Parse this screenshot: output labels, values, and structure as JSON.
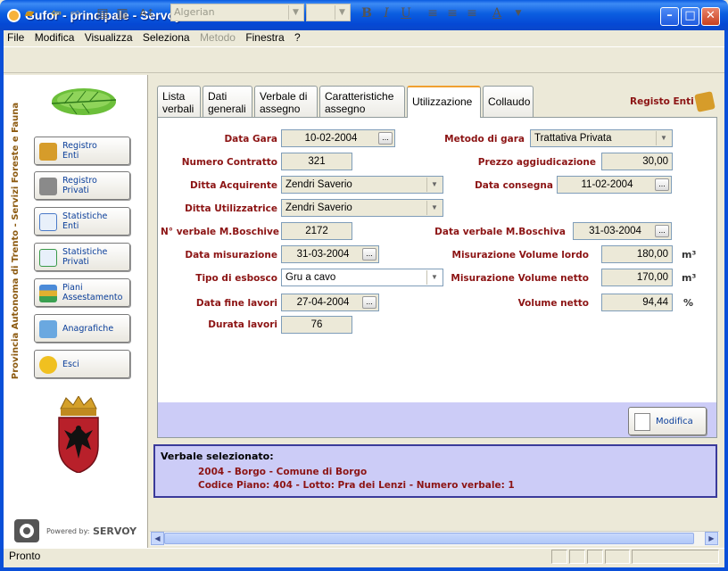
{
  "window": {
    "title": "Gufor - principale - Servoy Client"
  },
  "menu": [
    "File",
    "Modifica",
    "Visualizza",
    "Seleziona",
    "Metodo",
    "Finestra",
    "?"
  ],
  "menu_disabled": [
    "Metodo"
  ],
  "toolbar": {
    "font_name": "Algerian"
  },
  "sidebar": {
    "vertical_label": "Provincia Autonoma di Trento - Servizi Foreste e Fauna",
    "items": [
      {
        "label": "Registro\nEnti",
        "icon": "book-icon"
      },
      {
        "label": "Registro\nPrivati",
        "icon": "book-icon"
      },
      {
        "label": "Statistiche\nEnti",
        "icon": "chart-icon"
      },
      {
        "label": "Statistiche\nPrivati",
        "icon": "chart-icon"
      },
      {
        "label": "Piani\nAssestamento",
        "icon": "books-icon"
      },
      {
        "label": "Anagrafiche",
        "icon": "contact-card-icon"
      },
      {
        "label": "Esci",
        "icon": "footprints-icon"
      }
    ],
    "powered_by": "Powered by:",
    "brand": "SERVOY"
  },
  "tabs": [
    {
      "label": "Lista\nverbali"
    },
    {
      "label": "Dati\ngenerali"
    },
    {
      "label": "Verbale di\nassegno"
    },
    {
      "label": "Caratteristiche\nassegno"
    },
    {
      "label": "Utilizzazione",
      "active": true
    },
    {
      "label": "Collaudo"
    }
  ],
  "registo_link": "Registo Enti",
  "form": {
    "data_gara": {
      "label": "Data Gara",
      "value": "10-02-2004"
    },
    "numero_contratto": {
      "label": "Numero Contratto",
      "value": "321"
    },
    "ditta_acquirente": {
      "label": "Ditta Acquirente",
      "value": "Zendri Saverio"
    },
    "ditta_utilizzatrice": {
      "label": "Ditta Utilizzatrice",
      "value": "Zendri Saverio"
    },
    "n_verbale": {
      "label": "N° verbale M.Boschive",
      "value": "2172"
    },
    "data_misurazione": {
      "label": "Data misurazione",
      "value": "31-03-2004"
    },
    "tipo_esbosco": {
      "label": "Tipo di esbosco",
      "value": "Gru a cavo"
    },
    "data_fine_lavori": {
      "label": "Data fine lavori",
      "value": "27-04-2004"
    },
    "durata_lavori": {
      "label": "Durata lavori",
      "value": "76"
    },
    "metodo_gara": {
      "label": "Metodo di gara",
      "value": "Trattativa Privata"
    },
    "prezzo": {
      "label": "Prezzo aggiudicazione",
      "value": "30,00"
    },
    "data_consegna": {
      "label": "Data consegna",
      "value": "11-02-2004"
    },
    "data_verbale": {
      "label": "Data verbale M.Boschiva",
      "value": "31-03-2004"
    },
    "vol_lordo": {
      "label": "Misurazione Volume lordo",
      "value": "180,00",
      "unit": "m³"
    },
    "vol_netto_mis": {
      "label": "Misurazione Volume netto",
      "value": "170,00",
      "unit": "m³"
    },
    "volume_netto": {
      "label": "Volume netto",
      "value": "94,44",
      "unit": "%"
    }
  },
  "modifica_button": "Modifica",
  "selected": {
    "title": "Verbale selezionato:",
    "line1": "2004 - Borgo - Comune di Borgo",
    "line2": "Codice Piano: 404 - Lotto: Pra dei Lenzi - Numero verbale: 1"
  },
  "status": "Pronto",
  "colors": {
    "title_bar": "#0a5be0",
    "label_red": "#8c1414",
    "footer_lilac": "#ccccf7"
  }
}
